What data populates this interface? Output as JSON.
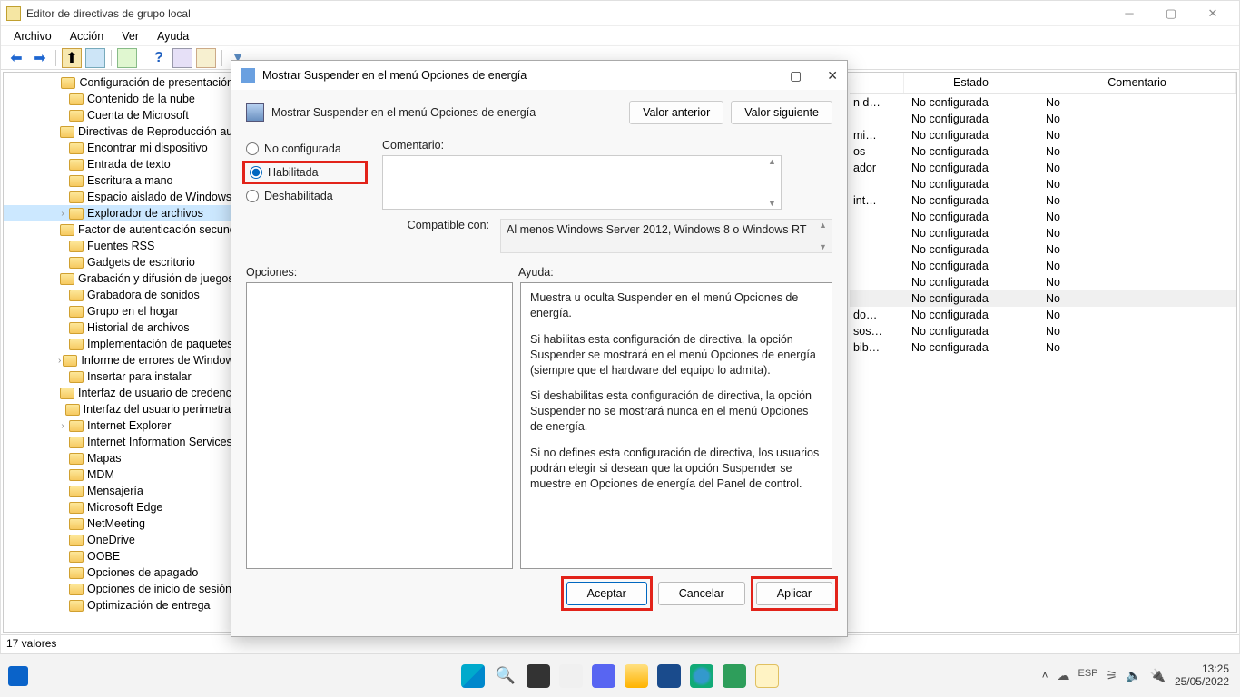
{
  "window_title": "Editor de directivas de grupo local",
  "menu": {
    "file": "Archivo",
    "action": "Acción",
    "view": "Ver",
    "help": "Ayuda"
  },
  "tree": [
    "Configuración de presentación",
    "Contenido de la nube",
    "Cuenta de Microsoft",
    "Directivas de Reproducción automática",
    "Encontrar mi dispositivo",
    "Entrada de texto",
    "Escritura a mano",
    "Espacio aislado de Windows",
    "Explorador de archivos",
    "Factor de autenticación secundario",
    "Fuentes RSS",
    "Gadgets de escritorio",
    "Grabación y difusión de juegos",
    "Grabadora de sonidos",
    "Grupo en el hogar",
    "Historial de archivos",
    "Implementación de paquetes",
    "Informe de errores de Windows",
    "Insertar para instalar",
    "Interfaz de usuario de credenciales",
    "Interfaz del usuario perimetral",
    "Internet Explorer",
    "Internet Information Services",
    "Mapas",
    "MDM",
    "Mensajería",
    "Microsoft Edge",
    "NetMeeting",
    "OneDrive",
    "OOBE",
    "Opciones de apagado",
    "Opciones de inicio de sesión",
    "Optimización de entrega"
  ],
  "tree_expanders": {
    "8": true,
    "17": true,
    "21": true
  },
  "tree_selected_index": 8,
  "tree_leaf_indices": [
    4,
    5,
    13,
    15,
    18,
    22,
    25,
    29,
    30
  ],
  "columns": {
    "state": "Estado",
    "comment": "Comentario"
  },
  "rows": [
    {
      "suffix": "n d…",
      "state": "No configurada",
      "comment": "No"
    },
    {
      "suffix": "",
      "state": "No configurada",
      "comment": "No"
    },
    {
      "suffix": "mi…",
      "state": "No configurada",
      "comment": "No"
    },
    {
      "suffix": "os",
      "state": "No configurada",
      "comment": "No"
    },
    {
      "suffix": "ador",
      "state": "No configurada",
      "comment": "No"
    },
    {
      "suffix": "",
      "state": "No configurada",
      "comment": "No"
    },
    {
      "suffix": "int…",
      "state": "No configurada",
      "comment": "No"
    },
    {
      "suffix": "",
      "state": "No configurada",
      "comment": "No"
    },
    {
      "suffix": "",
      "state": "No configurada",
      "comment": "No"
    },
    {
      "suffix": "",
      "state": "No configurada",
      "comment": "No"
    },
    {
      "suffix": "",
      "state": "No configurada",
      "comment": "No"
    },
    {
      "suffix": "",
      "state": "No configurada",
      "comment": "No"
    },
    {
      "suffix": "",
      "state": "No configurada",
      "comment": "No"
    },
    {
      "suffix": "do…",
      "state": "No configurada",
      "comment": "No"
    },
    {
      "suffix": "sos…",
      "state": "No configurada",
      "comment": "No"
    },
    {
      "suffix": "bib…",
      "state": "No configurada",
      "comment": "No"
    }
  ],
  "row_selected_index": 12,
  "statusbar": "17 valores",
  "dialog": {
    "title": "Mostrar Suspender en el menú Opciones de energía",
    "setting_name": "Mostrar Suspender en el menú Opciones de energía",
    "prev": "Valor anterior",
    "next": "Valor siguiente",
    "radio_notconfig": "No configurada",
    "radio_enabled": "Habilitada",
    "radio_disabled": "Deshabilitada",
    "comment_label": "Comentario:",
    "compat_label": "Compatible con:",
    "compat_text": "Al menos Windows Server 2012, Windows 8 o Windows RT",
    "options_label": "Opciones:",
    "help_label": "Ayuda:",
    "help_p1": "Muestra u oculta Suspender en el menú Opciones de energía.",
    "help_p2": "Si habilitas esta configuración de directiva, la opción Suspender se mostrará en el menú Opciones de energía (siempre que el hardware del equipo lo admita).",
    "help_p3": "Si deshabilitas esta configuración de directiva, la opción Suspender no se mostrará nunca en el menú Opciones de energía.",
    "help_p4": "Si no defines esta configuración de directiva, los usuarios podrán elegir si desean que la opción Suspender se muestre en Opciones de energía del Panel de control.",
    "ok": "Aceptar",
    "cancel": "Cancelar",
    "apply": "Aplicar"
  },
  "clock": {
    "time": "13:25",
    "date": "25/05/2022"
  }
}
